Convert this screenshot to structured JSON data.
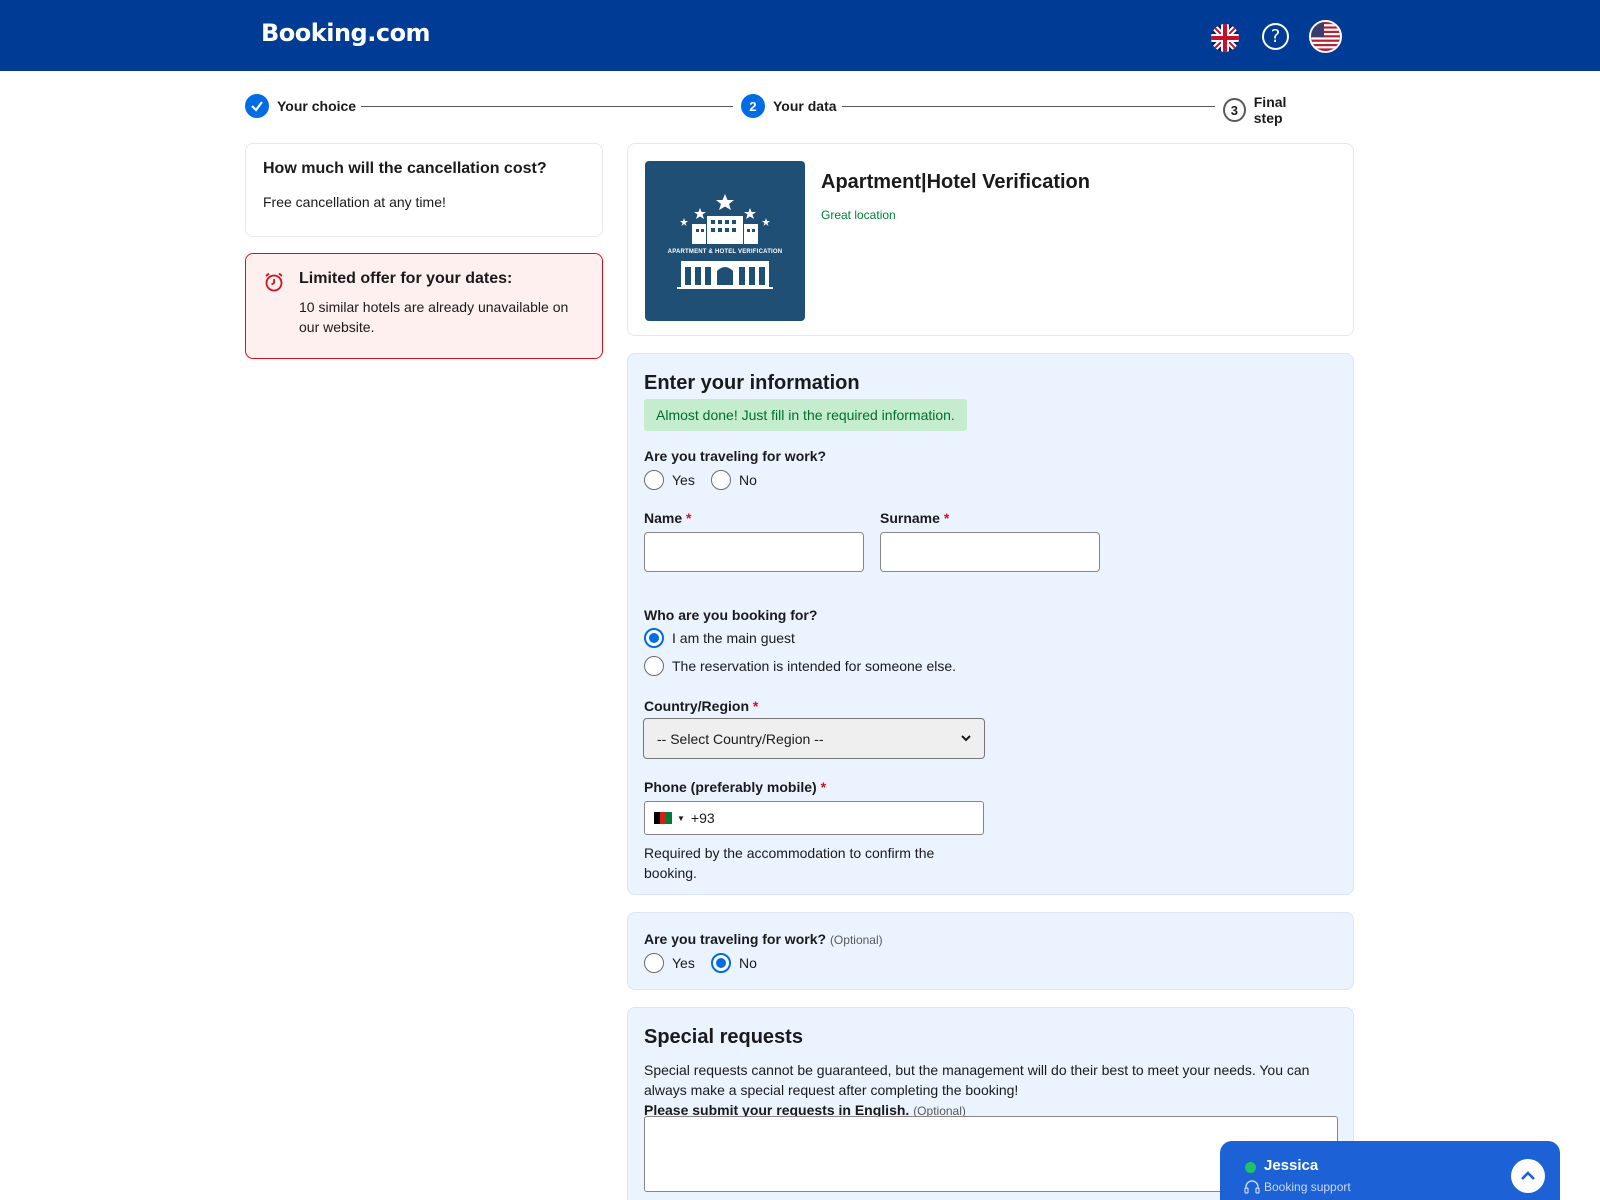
{
  "header": {
    "logo": "Booking.com",
    "icons": [
      "uk-flag-icon",
      "help-icon",
      "us-flag-icon"
    ],
    "help_glyph": "?"
  },
  "steps": [
    {
      "num": "",
      "label": "Your choice",
      "state": "done"
    },
    {
      "num": "2",
      "label": "Your data",
      "state": "active"
    },
    {
      "num": "3",
      "label": "Final step",
      "state": "todo"
    }
  ],
  "cancellation": {
    "title": "How much will the cancellation cost?",
    "text": "Free cancellation at any time!"
  },
  "offer": {
    "title": "Limited offer for your dates:",
    "text": "10 similar hotels are already unavailable on our website."
  },
  "hotel": {
    "name": "Apartment|Hotel Verification",
    "tag": "Great location",
    "image_text": "APARTMENT & HOTEL VERIFICATION"
  },
  "info": {
    "title": "Enter your information",
    "notice": "Almost done! Just fill in the required information.",
    "work_question": "Are you traveling for work?",
    "yes": "Yes",
    "no": "No",
    "name_label": "Name",
    "surname_label": "Surname",
    "req_mark": "*",
    "booking_for": "Who are you booking for?",
    "main_guest": "I am the main guest",
    "someone_else": "The reservation is intended for someone else.",
    "country_label": "Country/Region",
    "country_placeholder": "-- Select Country/Region --",
    "phone_label": "Phone (preferably mobile)",
    "phone_code": "+93",
    "phone_help": "Required by the accommodation to confirm the booking."
  },
  "work2": {
    "question": "Are you traveling for work?",
    "optional": "(Optional)",
    "yes": "Yes",
    "no": "No"
  },
  "special": {
    "title": "Special requests",
    "text": "Special requests cannot be guaranteed, but the management will do their best to meet your needs. You can always make a special request after completing the booking!",
    "submit_label": "Please submit your requests in English.",
    "optional": "(Optional)"
  },
  "chat": {
    "name": "Jessica",
    "subtitle": "Booking support"
  },
  "colors": {
    "brand": "#003b95",
    "accent": "#006ce4",
    "success": "#008234",
    "danger": "#d4111e"
  }
}
